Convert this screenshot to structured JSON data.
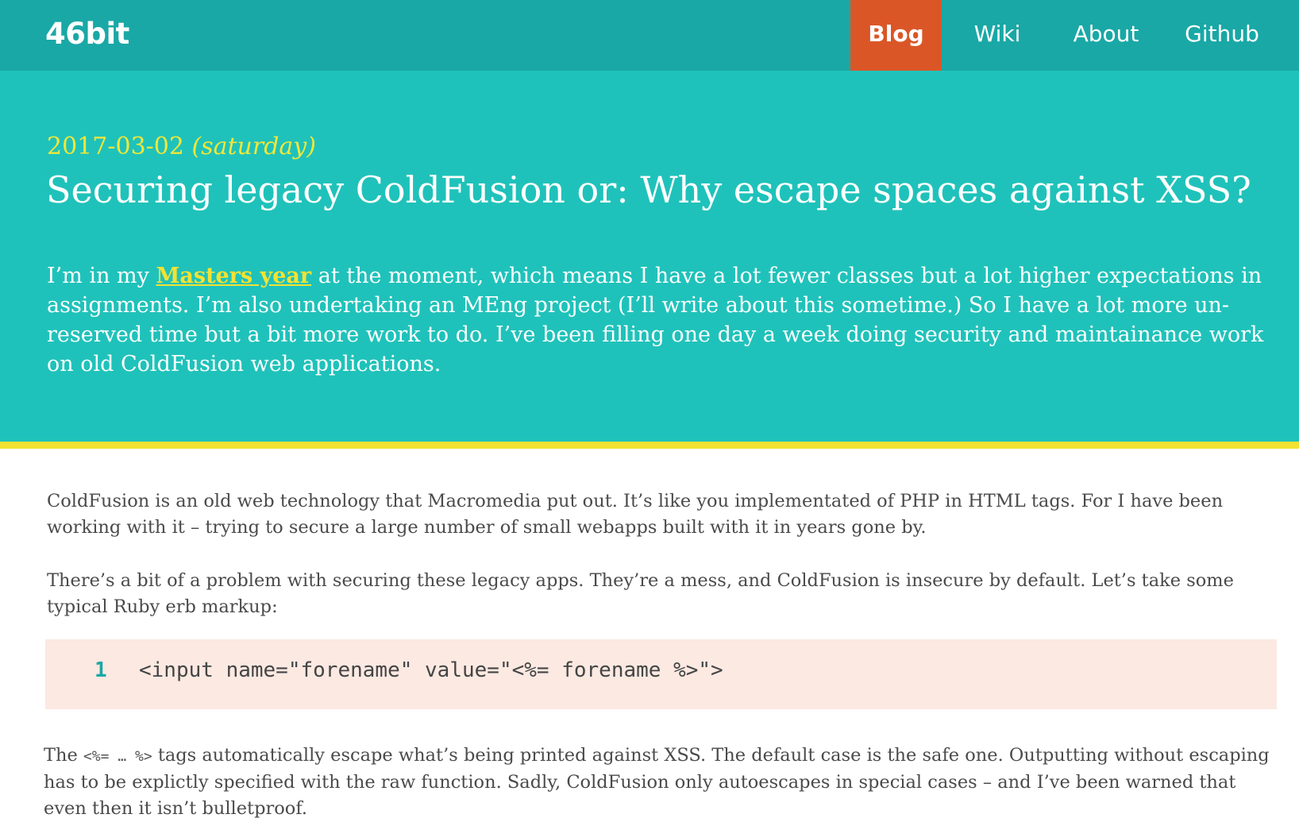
{
  "site": {
    "brand": "46bit"
  },
  "nav": {
    "items": [
      {
        "label": "Blog",
        "active": true
      },
      {
        "label": "Wiki",
        "active": false
      },
      {
        "label": "About",
        "active": false
      },
      {
        "label": "Github",
        "active": false
      }
    ]
  },
  "post": {
    "date": "2017-03-02",
    "weekday": "(saturday)",
    "title": "Securing legacy ColdFusion or: Why escape spaces against XSS?",
    "intro": {
      "prefix": "I’m in my ",
      "link_text": "Masters year",
      "suffix": " at the moment, which means I have a lot fewer classes but a lot higher expectations in assignments. I’m also undertaking an MEng project (I’ll write about this sometime.) So I have a lot more un-reserved time but a bit more work to do. I’ve been filling one day a week doing security and maintainance work on old ColdFusion web applications."
    },
    "paragraphs": [
      "ColdFusion is an old web technology that Macromedia put out. It’s like you implementated of PHP in HTML tags. For I have been working with it – trying to secure a large number of small webapps built with it in years gone by.",
      "There’s a bit of a problem with securing these legacy apps. They’re a mess, and ColdFusion is insecure by default. Let’s take some typical Ruby erb markup:"
    ],
    "code": {
      "line_number": "1",
      "text": "<input name=\"forename\" value=\"<%= forename %>\">"
    },
    "after_code": {
      "prefix": "The ",
      "inline_code": "<%= … %>",
      "suffix": " tags automatically escape what’s being printed against XSS. The default case is the safe one. Outputting without escaping has to be explictly specified with the raw function. Sadly, ColdFusion only autoescapes in special cases – and I’ve been warned that even then it isn’t bulletproof."
    }
  }
}
